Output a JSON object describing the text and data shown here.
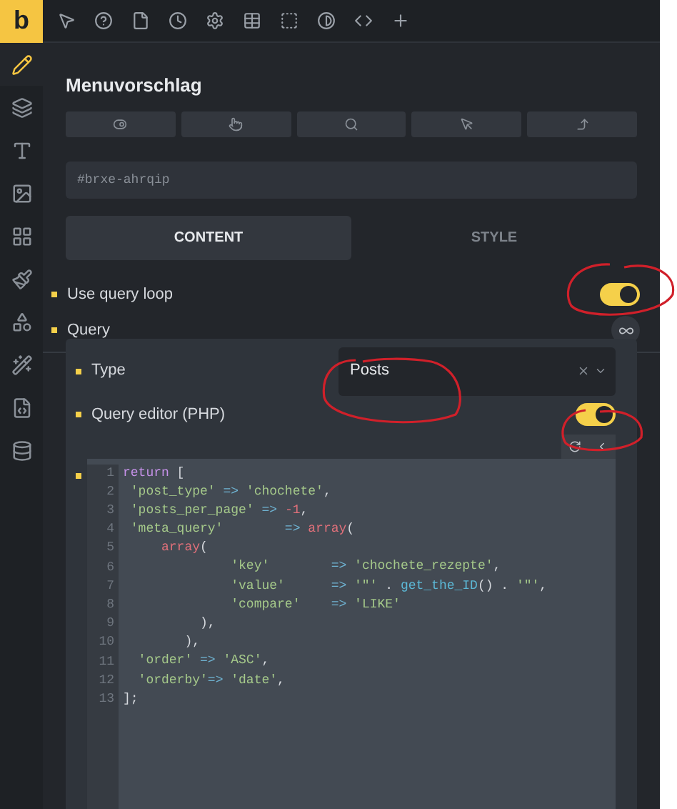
{
  "logo": "b",
  "sidebar": [
    {
      "selected": true
    },
    {
      "selected": false
    },
    {
      "selected": false
    },
    {
      "selected": false
    },
    {
      "selected": false
    },
    {
      "selected": false
    },
    {
      "selected": false
    },
    {
      "selected": false
    },
    {
      "selected": false
    },
    {
      "selected": false
    }
  ],
  "element_name": "Menuvorschlag",
  "element_id": {
    "placeholder": "#brxe-ahrqip"
  },
  "tabs": [
    {
      "label": "CONTENT",
      "selected": true
    },
    {
      "label": "STYLE",
      "selected": false
    }
  ],
  "controls": [
    {
      "kind": "toggle",
      "label": "Use query loop",
      "on": true
    },
    {
      "kind": "link",
      "label": "Query"
    }
  ],
  "query_panel": {
    "type": {
      "label": "Type",
      "value": "Posts"
    },
    "php_editor": {
      "label": "Query editor (PHP)",
      "on": true
    },
    "code": [
      {
        "number": "1",
        "tokens": [
          {
            "kind": "keyword",
            "text": "return"
          },
          {
            "kind": "plain",
            "text": " ["
          }
        ]
      },
      {
        "number": "2",
        "tokens": [
          {
            "kind": "string",
            "text": " 'post_type'"
          },
          {
            "kind": "operator",
            "text": " => "
          },
          {
            "kind": "string",
            "text": "'chochete'"
          },
          {
            "kind": "plain",
            "text": ","
          }
        ]
      },
      {
        "number": "3",
        "tokens": [
          {
            "kind": "string",
            "text": " 'posts_per_page'"
          },
          {
            "kind": "operator",
            "text": " => "
          },
          {
            "kind": "number",
            "text": "-1"
          },
          {
            "kind": "plain",
            "text": ","
          }
        ]
      },
      {
        "number": "4",
        "tokens": [
          {
            "kind": "string",
            "text": " 'meta_query'"
          },
          {
            "kind": "operator",
            "text": "        => "
          },
          {
            "kind": "builtin",
            "text": "array"
          },
          {
            "kind": "plain",
            "text": "("
          }
        ]
      },
      {
        "number": "5",
        "tokens": [
          {
            "kind": "builtin",
            "text": "     array"
          },
          {
            "kind": "plain",
            "text": "("
          }
        ]
      },
      {
        "number": "6",
        "tokens": [
          {
            "kind": "string",
            "text": "              'key'"
          },
          {
            "kind": "operator",
            "text": "        => "
          },
          {
            "kind": "string",
            "text": "'chochete_rezepte'"
          },
          {
            "kind": "plain",
            "text": ","
          }
        ]
      },
      {
        "number": "7",
        "tokens": [
          {
            "kind": "string",
            "text": "              'value'"
          },
          {
            "kind": "operator",
            "text": "      => "
          },
          {
            "kind": "string",
            "text": "'\"'"
          },
          {
            "kind": "plain",
            "text": " . "
          },
          {
            "kind": "function",
            "text": "get_the_ID"
          },
          {
            "kind": "plain",
            "text": "() . "
          },
          {
            "kind": "string",
            "text": "'\"'"
          },
          {
            "kind": "plain",
            "text": ","
          }
        ]
      },
      {
        "number": "8",
        "tokens": [
          {
            "kind": "string",
            "text": "              'compare'"
          },
          {
            "kind": "operator",
            "text": "    => "
          },
          {
            "kind": "string",
            "text": "'LIKE'"
          }
        ]
      },
      {
        "number": "9",
        "tokens": [
          {
            "kind": "plain",
            "text": "          ),"
          }
        ]
      },
      {
        "number": "10",
        "tokens": [
          {
            "kind": "plain",
            "text": "        ),"
          }
        ]
      },
      {
        "number": "11",
        "tokens": [
          {
            "kind": "string",
            "text": "  'order'"
          },
          {
            "kind": "operator",
            "text": " => "
          },
          {
            "kind": "string",
            "text": "'ASC'"
          },
          {
            "kind": "plain",
            "text": ","
          }
        ]
      },
      {
        "number": "12",
        "tokens": [
          {
            "kind": "string",
            "text": "  'orderby'"
          },
          {
            "kind": "operator",
            "text": "=> "
          },
          {
            "kind": "string",
            "text": "'date'"
          },
          {
            "kind": "plain",
            "text": ","
          }
        ]
      },
      {
        "number": "13",
        "tokens": [
          {
            "kind": "plain",
            "text": "];"
          }
        ]
      }
    ]
  }
}
